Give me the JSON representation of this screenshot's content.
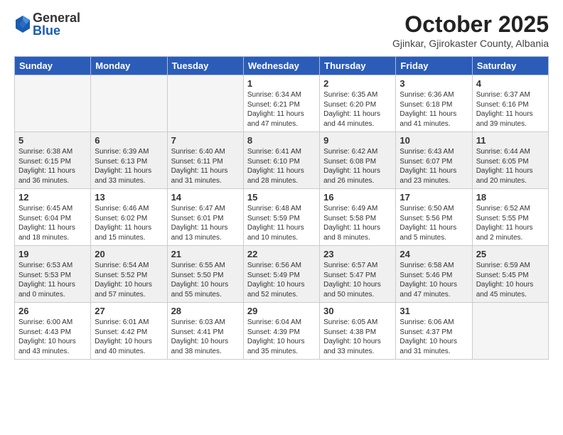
{
  "logo": {
    "general": "General",
    "blue": "Blue"
  },
  "header": {
    "month": "October 2025",
    "location": "Gjinkar, Gjirokaster County, Albania"
  },
  "weekdays": [
    "Sunday",
    "Monday",
    "Tuesday",
    "Wednesday",
    "Thursday",
    "Friday",
    "Saturday"
  ],
  "weeks": [
    [
      {
        "day": "",
        "info": ""
      },
      {
        "day": "",
        "info": ""
      },
      {
        "day": "",
        "info": ""
      },
      {
        "day": "1",
        "info": "Sunrise: 6:34 AM\nSunset: 6:21 PM\nDaylight: 11 hours\nand 47 minutes."
      },
      {
        "day": "2",
        "info": "Sunrise: 6:35 AM\nSunset: 6:20 PM\nDaylight: 11 hours\nand 44 minutes."
      },
      {
        "day": "3",
        "info": "Sunrise: 6:36 AM\nSunset: 6:18 PM\nDaylight: 11 hours\nand 41 minutes."
      },
      {
        "day": "4",
        "info": "Sunrise: 6:37 AM\nSunset: 6:16 PM\nDaylight: 11 hours\nand 39 minutes."
      }
    ],
    [
      {
        "day": "5",
        "info": "Sunrise: 6:38 AM\nSunset: 6:15 PM\nDaylight: 11 hours\nand 36 minutes."
      },
      {
        "day": "6",
        "info": "Sunrise: 6:39 AM\nSunset: 6:13 PM\nDaylight: 11 hours\nand 33 minutes."
      },
      {
        "day": "7",
        "info": "Sunrise: 6:40 AM\nSunset: 6:11 PM\nDaylight: 11 hours\nand 31 minutes."
      },
      {
        "day": "8",
        "info": "Sunrise: 6:41 AM\nSunset: 6:10 PM\nDaylight: 11 hours\nand 28 minutes."
      },
      {
        "day": "9",
        "info": "Sunrise: 6:42 AM\nSunset: 6:08 PM\nDaylight: 11 hours\nand 26 minutes."
      },
      {
        "day": "10",
        "info": "Sunrise: 6:43 AM\nSunset: 6:07 PM\nDaylight: 11 hours\nand 23 minutes."
      },
      {
        "day": "11",
        "info": "Sunrise: 6:44 AM\nSunset: 6:05 PM\nDaylight: 11 hours\nand 20 minutes."
      }
    ],
    [
      {
        "day": "12",
        "info": "Sunrise: 6:45 AM\nSunset: 6:04 PM\nDaylight: 11 hours\nand 18 minutes."
      },
      {
        "day": "13",
        "info": "Sunrise: 6:46 AM\nSunset: 6:02 PM\nDaylight: 11 hours\nand 15 minutes."
      },
      {
        "day": "14",
        "info": "Sunrise: 6:47 AM\nSunset: 6:01 PM\nDaylight: 11 hours\nand 13 minutes."
      },
      {
        "day": "15",
        "info": "Sunrise: 6:48 AM\nSunset: 5:59 PM\nDaylight: 11 hours\nand 10 minutes."
      },
      {
        "day": "16",
        "info": "Sunrise: 6:49 AM\nSunset: 5:58 PM\nDaylight: 11 hours\nand 8 minutes."
      },
      {
        "day": "17",
        "info": "Sunrise: 6:50 AM\nSunset: 5:56 PM\nDaylight: 11 hours\nand 5 minutes."
      },
      {
        "day": "18",
        "info": "Sunrise: 6:52 AM\nSunset: 5:55 PM\nDaylight: 11 hours\nand 2 minutes."
      }
    ],
    [
      {
        "day": "19",
        "info": "Sunrise: 6:53 AM\nSunset: 5:53 PM\nDaylight: 11 hours\nand 0 minutes."
      },
      {
        "day": "20",
        "info": "Sunrise: 6:54 AM\nSunset: 5:52 PM\nDaylight: 10 hours\nand 57 minutes."
      },
      {
        "day": "21",
        "info": "Sunrise: 6:55 AM\nSunset: 5:50 PM\nDaylight: 10 hours\nand 55 minutes."
      },
      {
        "day": "22",
        "info": "Sunrise: 6:56 AM\nSunset: 5:49 PM\nDaylight: 10 hours\nand 52 minutes."
      },
      {
        "day": "23",
        "info": "Sunrise: 6:57 AM\nSunset: 5:47 PM\nDaylight: 10 hours\nand 50 minutes."
      },
      {
        "day": "24",
        "info": "Sunrise: 6:58 AM\nSunset: 5:46 PM\nDaylight: 10 hours\nand 47 minutes."
      },
      {
        "day": "25",
        "info": "Sunrise: 6:59 AM\nSunset: 5:45 PM\nDaylight: 10 hours\nand 45 minutes."
      }
    ],
    [
      {
        "day": "26",
        "info": "Sunrise: 6:00 AM\nSunset: 4:43 PM\nDaylight: 10 hours\nand 43 minutes."
      },
      {
        "day": "27",
        "info": "Sunrise: 6:01 AM\nSunset: 4:42 PM\nDaylight: 10 hours\nand 40 minutes."
      },
      {
        "day": "28",
        "info": "Sunrise: 6:03 AM\nSunset: 4:41 PM\nDaylight: 10 hours\nand 38 minutes."
      },
      {
        "day": "29",
        "info": "Sunrise: 6:04 AM\nSunset: 4:39 PM\nDaylight: 10 hours\nand 35 minutes."
      },
      {
        "day": "30",
        "info": "Sunrise: 6:05 AM\nSunset: 4:38 PM\nDaylight: 10 hours\nand 33 minutes."
      },
      {
        "day": "31",
        "info": "Sunrise: 6:06 AM\nSunset: 4:37 PM\nDaylight: 10 hours\nand 31 minutes."
      },
      {
        "day": "",
        "info": ""
      }
    ]
  ]
}
